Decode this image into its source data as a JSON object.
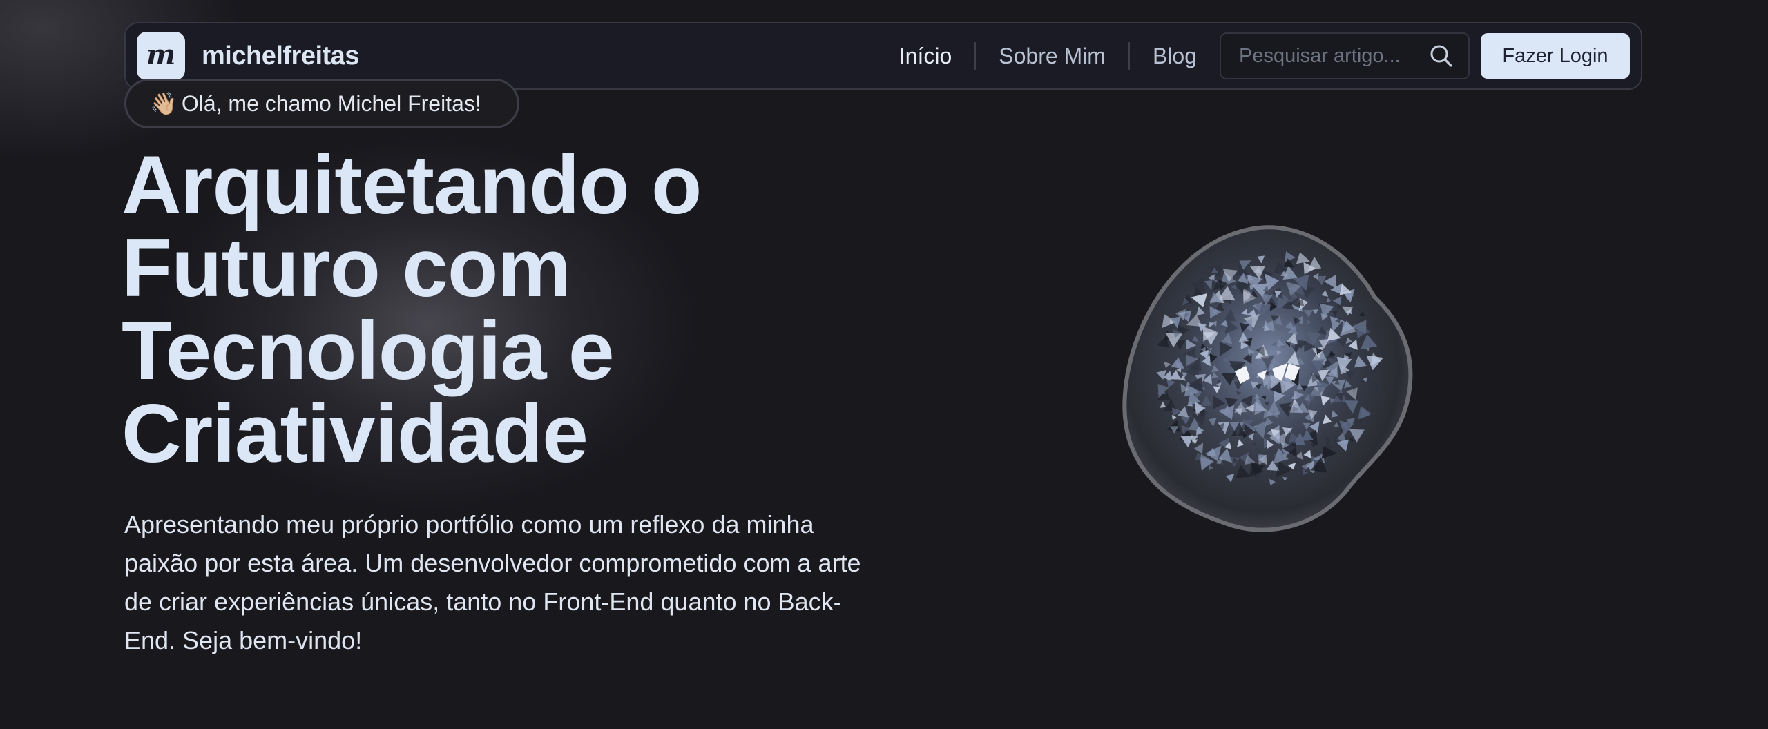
{
  "navbar": {
    "brand": {
      "logo_letter": "m",
      "name": "michelfreitas"
    },
    "links": [
      {
        "label": "Início",
        "active": true
      },
      {
        "label": "Sobre Mim",
        "active": false
      },
      {
        "label": "Blog",
        "active": false
      }
    ],
    "search": {
      "placeholder": "Pesquisar artigo...",
      "value": "",
      "icon": "search-icon"
    },
    "login_label": "Fazer Login"
  },
  "badge": {
    "emoji": "👋🏼",
    "text": "Olá, me chamo Michel Freitas!"
  },
  "hero": {
    "title_lines": [
      "Arquitetando o",
      "Futuro com",
      "Tecnologia e",
      "Criatividade"
    ],
    "description": "Apresentando meu próprio portfólio como um reflexo da minha paixão por esta área. Um desenvolvedor comprometido com a arte de criar experiências únicas, tanto no Front-End quanto no Back-End. Seja bem-vindo!"
  },
  "colors": {
    "background": "#19181d",
    "accent": "#dbe7f6",
    "navbar_bg": "#1b1b25",
    "text_primary": "#dbe7f7",
    "text_muted": "#b8c2d2"
  }
}
